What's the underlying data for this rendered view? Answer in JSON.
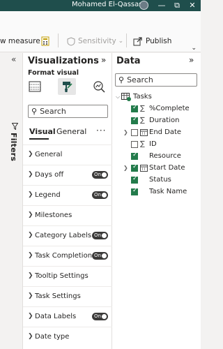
{
  "titlebar": {
    "user": "Mohamed El-Qassas",
    "minimize": "—",
    "restore": "⧉",
    "close": "✕"
  },
  "ribbon": {
    "new_measure": "w measure",
    "sensitivity": "Sensitivity",
    "sensitivity_caret": "⌄",
    "publish": "Publish",
    "collapse": "⌄"
  },
  "filters": {
    "collapse": "«",
    "label": "Filters"
  },
  "visualizations": {
    "title": "Visualizations",
    "expand": "»",
    "format_label": "Format visual",
    "search_placeholder": "Search",
    "tabs": [
      "Visual",
      "General"
    ],
    "more": "···",
    "sections": [
      {
        "label": "General",
        "toggle": ""
      },
      {
        "label": "Days off",
        "toggle": "On"
      },
      {
        "label": "Legend",
        "toggle": "On"
      },
      {
        "label": "Milestones",
        "toggle": ""
      },
      {
        "label": "Category Labels",
        "toggle": "On"
      },
      {
        "label": "Task Completion",
        "toggle": "On"
      },
      {
        "label": "Tooltip Settings",
        "toggle": ""
      },
      {
        "label": "Task Settings",
        "toggle": ""
      },
      {
        "label": "Data Labels",
        "toggle": "On"
      },
      {
        "label": "Date type",
        "toggle": ""
      }
    ]
  },
  "data": {
    "title": "Data",
    "expand": "»",
    "search_placeholder": "Search",
    "table": "Tasks",
    "fields": [
      {
        "name": "%Complete",
        "icon": "∑",
        "checked": true,
        "expandable": false
      },
      {
        "name": "Duration",
        "icon": "∑",
        "checked": true,
        "expandable": false
      },
      {
        "name": "End Date",
        "icon": "calendar",
        "checked": false,
        "expandable": true
      },
      {
        "name": "ID",
        "icon": "∑",
        "checked": false,
        "expandable": false
      },
      {
        "name": "Resource",
        "icon": "",
        "checked": true,
        "expandable": false
      },
      {
        "name": "Start Date",
        "icon": "calendar",
        "checked": true,
        "expandable": true
      },
      {
        "name": "Status",
        "icon": "",
        "checked": true,
        "expandable": false
      },
      {
        "name": "Task Name",
        "icon": "",
        "checked": true,
        "expandable": false
      }
    ]
  }
}
